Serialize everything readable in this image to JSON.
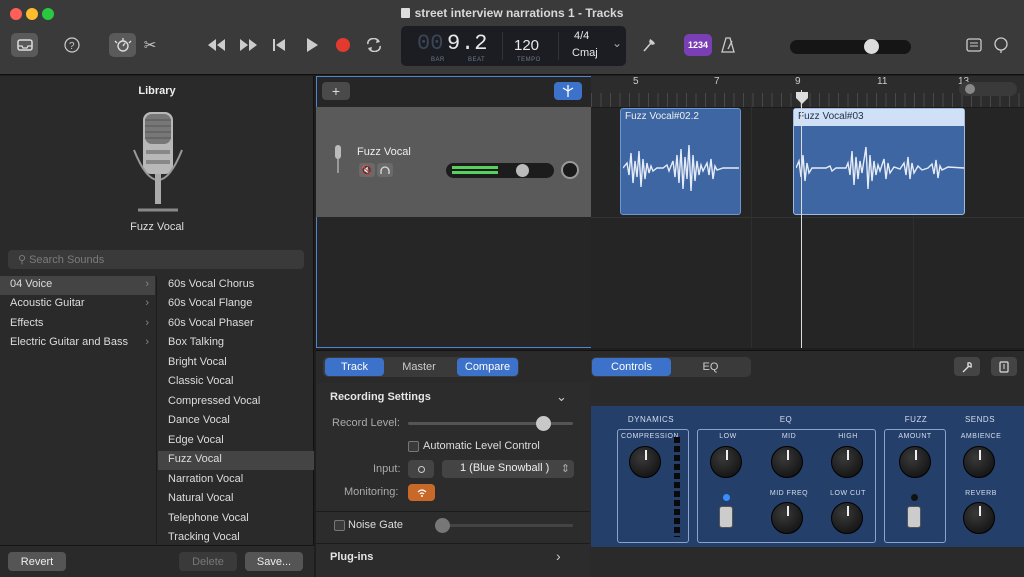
{
  "window": {
    "title": "street interview narrations 1 - Tracks"
  },
  "lcd": {
    "bar": "9",
    "beat": ".2",
    "bar_label": "BAR",
    "beat_label": "BEAT",
    "tempo": "120",
    "tempo_label": "TEMPO",
    "signature": "4/4",
    "key": "Cmaj",
    "count_in": "1234"
  },
  "library": {
    "title": "Library",
    "selected_patch": "Fuzz Vocal",
    "search_placeholder": "Search Sounds",
    "categories": [
      "04 Voice",
      "Acoustic Guitar",
      "Effects",
      "Electric Guitar and Bass"
    ],
    "items": [
      "60s Vocal Chorus",
      "60s Vocal Flange",
      "60s Vocal Phaser",
      "Box Talking",
      "Bright Vocal",
      "Classic Vocal",
      "Compressed Vocal",
      "Dance Vocal",
      "Edge Vocal",
      "Fuzz Vocal",
      "Narration Vocal",
      "Natural Vocal",
      "Telephone Vocal",
      "Tracking Vocal"
    ],
    "revert": "Revert",
    "delete": "Delete",
    "save": "Save..."
  },
  "track": {
    "name": "Fuzz Vocal"
  },
  "ruler": {
    "bars": [
      "5",
      "7",
      "9",
      "11",
      "13"
    ]
  },
  "regions": [
    {
      "name": "Fuzz Vocal#02.2"
    },
    {
      "name": "Fuzz Vocal#03"
    }
  ],
  "tabs": {
    "track": "Track",
    "master": "Master",
    "compare": "Compare",
    "controls": "Controls",
    "eq": "EQ"
  },
  "recording": {
    "header": "Recording Settings",
    "record_level_label": "Record Level:",
    "auto_level": "Automatic Level Control",
    "input_label": "Input:",
    "input_value": "1  (Blue Snowball )",
    "monitoring_label": "Monitoring:",
    "noise_gate": "Noise Gate",
    "plugins": "Plug-ins"
  },
  "plugin": {
    "dynamics": "DYNAMICS",
    "compression": "COMPRESSION",
    "eq": "EQ",
    "low": "LOW",
    "mid": "MID",
    "high": "HIGH",
    "mid_freq": "MID FREQ",
    "low_cut": "LOW CUT",
    "fuzz": "FUZZ",
    "amount": "AMOUNT",
    "sends": "SENDS",
    "ambience": "AMBIENCE",
    "reverb": "REVERB"
  },
  "colors": {
    "accent": "#3c72c9",
    "region": "#3d66a3",
    "record": "#e23a2e",
    "monitoring": "#c8692a",
    "count_in": "#7b3fb5"
  }
}
